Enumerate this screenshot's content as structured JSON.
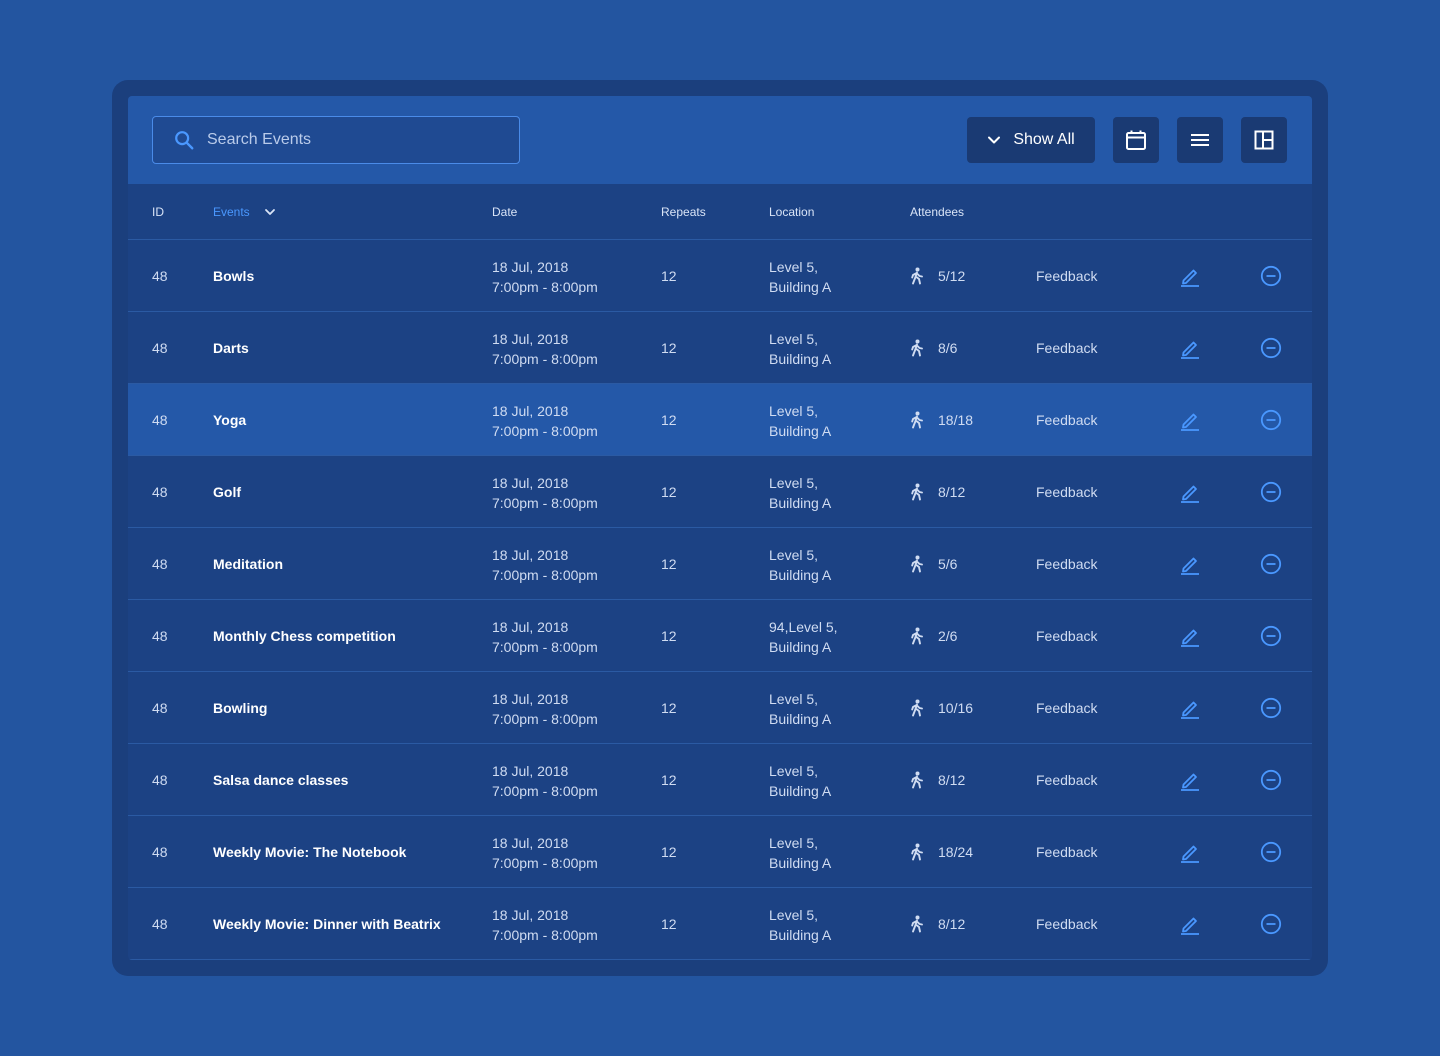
{
  "colors": {
    "background": "#2355a0",
    "panel": "#1b3f7d",
    "toolbar": "#2458a8",
    "accent": "#4a98ff",
    "selected_row": "#2458a8"
  },
  "search": {
    "placeholder": "Search Events",
    "icon": "search-icon"
  },
  "toolbar": {
    "filter_label": "Show All",
    "filter_icon": "chevron-down-icon",
    "calendar_icon": "calendar-icon",
    "list_icon": "list-view-icon",
    "grid_icon": "grid-view-icon"
  },
  "table": {
    "headers": {
      "id": "ID",
      "events": "Events",
      "date": "Date",
      "repeats": "Repeats",
      "location": "Location",
      "attendees": "Attendees"
    },
    "sorted_column": "events",
    "selected_row_index": 2,
    "rows": [
      {
        "id": "48",
        "name": "Bowls",
        "date": "18 Jul, 2018",
        "time": "7:00pm - 8:00pm",
        "repeats": "12",
        "loc1": "Level 5,",
        "loc2": "Building A",
        "attendees": "5/12",
        "feedback": "Feedback"
      },
      {
        "id": "48",
        "name": "Darts",
        "date": "18 Jul, 2018",
        "time": "7:00pm - 8:00pm",
        "repeats": "12",
        "loc1": "Level 5,",
        "loc2": "Building A",
        "attendees": "8/6",
        "feedback": "Feedback"
      },
      {
        "id": "48",
        "name": "Yoga",
        "date": "18 Jul, 2018",
        "time": "7:00pm - 8:00pm",
        "repeats": "12",
        "loc1": "Level 5,",
        "loc2": "Building A",
        "attendees": "18/18",
        "feedback": "Feedback"
      },
      {
        "id": "48",
        "name": "Golf",
        "date": "18 Jul, 2018",
        "time": "7:00pm - 8:00pm",
        "repeats": "12",
        "loc1": "Level 5,",
        "loc2": "Building A",
        "attendees": "8/12",
        "feedback": "Feedback"
      },
      {
        "id": "48",
        "name": "Meditation",
        "date": "18 Jul, 2018",
        "time": "7:00pm - 8:00pm",
        "repeats": "12",
        "loc1": "Level 5,",
        "loc2": "Building A",
        "attendees": "5/6",
        "feedback": "Feedback"
      },
      {
        "id": "48",
        "name": "Monthly Chess competition",
        "date": "18 Jul, 2018",
        "time": "7:00pm - 8:00pm",
        "repeats": "12",
        "loc1": "94,Level 5,",
        "loc2": "Building A",
        "attendees": "2/6",
        "feedback": "Feedback"
      },
      {
        "id": "48",
        "name": "Bowling",
        "date": "18 Jul, 2018",
        "time": "7:00pm - 8:00pm",
        "repeats": "12",
        "loc1": "Level 5,",
        "loc2": "Building A",
        "attendees": "10/16",
        "feedback": "Feedback"
      },
      {
        "id": "48",
        "name": "Salsa dance classes",
        "date": "18 Jul, 2018",
        "time": "7:00pm - 8:00pm",
        "repeats": "12",
        "loc1": "Level 5,",
        "loc2": "Building A",
        "attendees": "8/12",
        "feedback": "Feedback"
      },
      {
        "id": "48",
        "name": "Weekly Movie: The Notebook",
        "date": "18 Jul, 2018",
        "time": "7:00pm - 8:00pm",
        "repeats": "12",
        "loc1": "Level 5,",
        "loc2": "Building A",
        "attendees": "18/24",
        "feedback": "Feedback"
      },
      {
        "id": "48",
        "name": "Weekly Movie: Dinner with Beatrix",
        "date": "18 Jul, 2018",
        "time": "7:00pm - 8:00pm",
        "repeats": "12",
        "loc1": "Level 5,",
        "loc2": "Building A",
        "attendees": "8/12",
        "feedback": "Feedback"
      }
    ]
  }
}
